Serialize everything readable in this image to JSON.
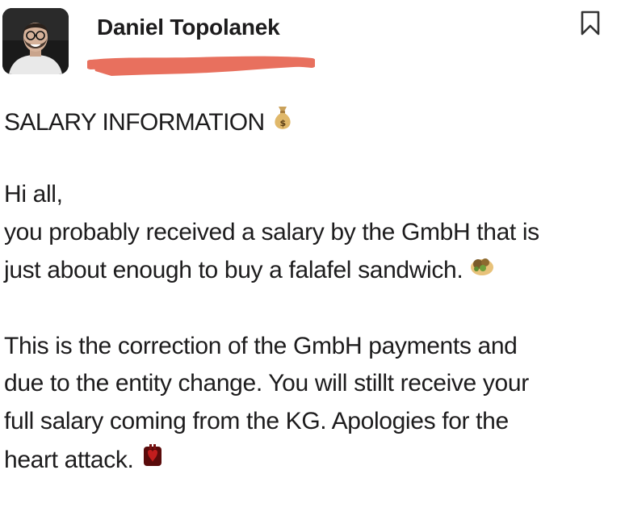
{
  "message": {
    "author": "Daniel Topolanek",
    "subject": "SALARY INFORMATION",
    "subject_emoji": "money-bag-icon",
    "body_lines": [
      "Hi all,",
      "you probably received a salary by the GmbH that is",
      "just about enough to buy a falafel sandwich.",
      "This is the correction of the GmbH payments and",
      "due to the entity change. You will stillt receive your",
      "full salary  coming from the KG. Apologies for the",
      "heart attack."
    ],
    "line_emojis": {
      "falafel": "falafel-icon",
      "heart_attack": "anatomical-heart-icon"
    }
  },
  "colors": {
    "text": "#1d1c1d",
    "redaction": "#e8705e",
    "background": "#ffffff"
  }
}
